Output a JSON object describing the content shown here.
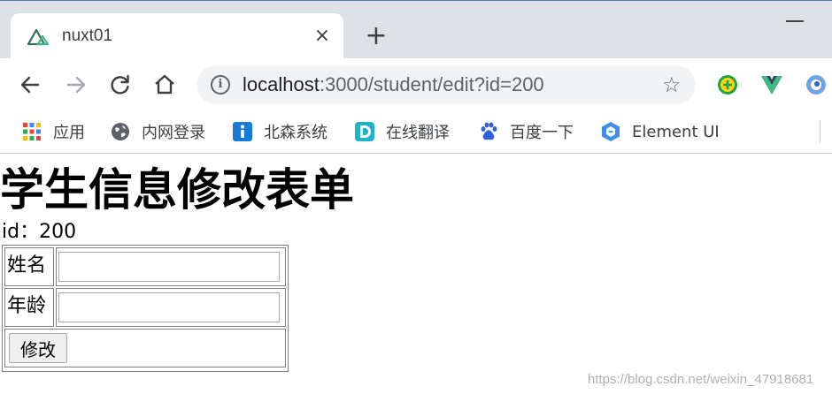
{
  "tab": {
    "title": "nuxt01",
    "close": "×"
  },
  "new_tab": "+",
  "address_bar": {
    "host": "localhost",
    "rest": ":3000/student/edit?id=200"
  },
  "bookmarks": [
    {
      "label": "应用",
      "icon": "apps-grid-icon"
    },
    {
      "label": "内网登录",
      "icon": "globe-icon"
    },
    {
      "label": "北森系统",
      "icon": "info-square-icon"
    },
    {
      "label": "在线翻译",
      "icon": "translate-d-icon"
    },
    {
      "label": "百度一下",
      "icon": "baidu-paw-icon"
    },
    {
      "label": "Element UI",
      "icon": "element-hexagon-icon"
    }
  ],
  "page": {
    "heading": "学生信息修改表单",
    "id_line": "id：200",
    "form": {
      "name_label": "姓名",
      "name_value": "",
      "age_label": "年龄",
      "age_value": "",
      "submit_label": "修改"
    }
  },
  "watermark": "https://blog.csdn.net/weixin_47918681",
  "colors": {
    "tabstrip": "#dee1e6",
    "omnibox": "#f1f3f4",
    "vue_green": "#41b883",
    "vue_dark": "#35495e"
  }
}
